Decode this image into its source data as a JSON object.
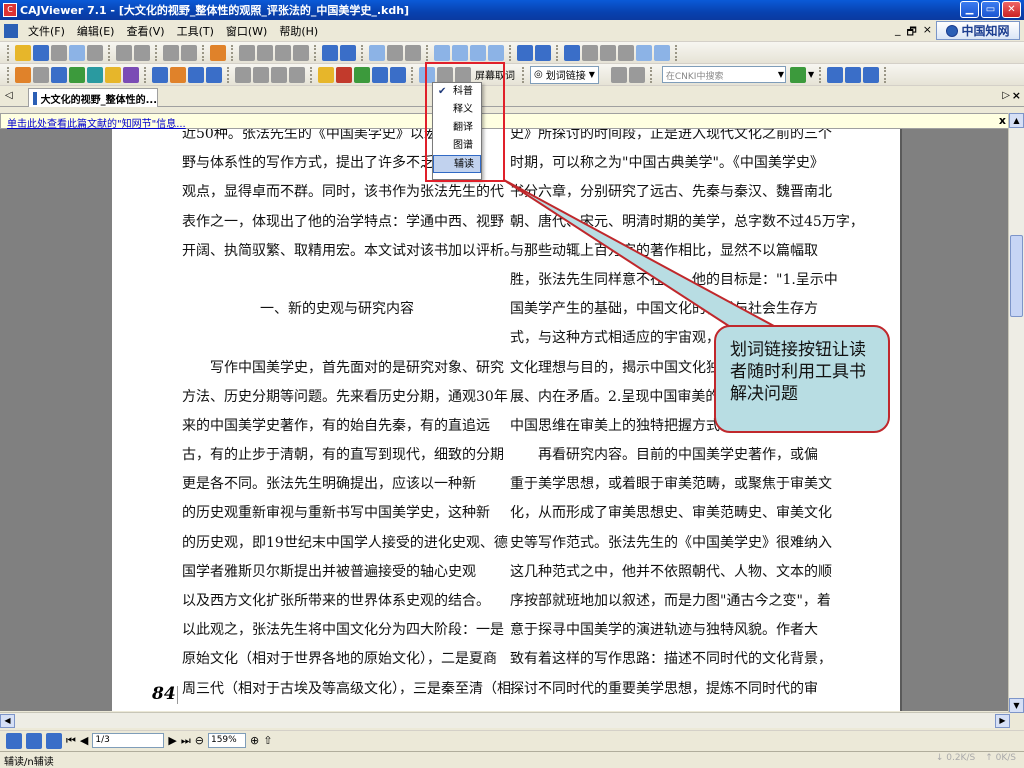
{
  "window": {
    "title": "CAJViewer 7.1 - [大文化的视野_整体性的观照_评张法的_中国美学史_.kdh]",
    "buttons": {
      "minimize": "▁",
      "maximize": "▭",
      "close": "✕"
    }
  },
  "menubar": {
    "items": [
      "文件(F)",
      "编辑(E)",
      "查看(V)",
      "工具(T)",
      "窗口(W)",
      "帮助(H)"
    ],
    "mdi_controls": [
      "_",
      "🗗",
      "×"
    ],
    "brand": "中国知网"
  },
  "toolbar2": {
    "screen_capture_label": "屏幕取词",
    "word_link_button": "划词链接",
    "search_placeholder": "在CNKI中搜索"
  },
  "word_link_menu": {
    "items": [
      {
        "label": "科普",
        "checked": true
      },
      {
        "label": "释义",
        "checked": false
      },
      {
        "label": "翻译",
        "checked": false
      },
      {
        "label": "图谱",
        "checked": false
      },
      {
        "label": "辅读",
        "checked": false,
        "hover": true
      }
    ]
  },
  "tabs": {
    "active_doc": "大文化的视野_整体性的...",
    "left_arrow": "◁",
    "right_arrow": "▷",
    "close": "×"
  },
  "infobar": {
    "link_text": "单击此处查看此篇文献的\"知网节\"信息...",
    "close": "x"
  },
  "document": {
    "left_column": [
      "近50种。张法先生的《中国美学史》以宏阔的视",
      "野与体系性的写作方式，提出了许多不乏新意的",
      "观点，显得卓而不群。同时，该书作为张法先生的代",
      "表作之一，体现出了他的治学特点：学通中西、视野",
      "开阔、执简驭繁、取精用宏。本文试对该书加以评析。",
      "",
      "一、新的史观与研究内容",
      "",
      "　　写作中国美学史，首先面对的是研究对象、研究",
      "方法、历史分期等问题。先来看历史分期，通观30年",
      "来的中国美学史著作，有的始自先秦，有的直追远",
      "古，有的止步于清朝，有的直写到现代，细致的分期",
      "更是各不同。张法先生明确提出，应该以一种新",
      "的历史观重新审视与重新书写中国美学史，这种新",
      "的历史观，即19世纪末中国学人接受的进化史观、德",
      "国学者雅斯贝尔斯提出并被普遍接受的轴心史观",
      "以及西方文化扩张所带来的世界体系史观的结合。",
      "以此观之，张法先生将中国文化分为四大阶段：一是",
      "原始文化（相对于世界各地的原始文化），二是夏商",
      "周三代（相对于古埃及等高级文化），三是秦至清（相"
    ],
    "right_column": [
      "史》所探讨的时间段，正是进入现代文化之前的三个",
      "时期，可以称之为\"中国古典美学\"。《中国美学史》",
      "书分六章，分别研究了远古、先秦与秦汉、魏晋南北",
      "朝、唐代、宋元、明清时期的美学，总字数不过45万字，",
      "与那些动辄上百万字的著作相比，显然不以篇幅取",
      "胜，张法先生同样意不在此，他的目标是：\"1.呈示中",
      "国美学产生的基础，中国文化的自然与社会生存方",
      "式，与这种方式相适应的宇宙观，生于其中的",
      "文化理想与目的，揭示中国文化独",
      "展、内在矛盾。2.呈现中国审美的",
      "中国思维在审美上的独特把握方式",
      "　　再看研究内容。目前的中国美学史著作，或偏",
      "重于美学思想，或着眼于审美范畴，或聚焦于审美文",
      "化，从而形成了审美思想史、审美范畴史、审美文化",
      "史等写作范式。张法先生的《中国美学史》很难纳入",
      "这几种范式之中，他并不依照朝代、人物、文本的顺",
      "序按部就班地加以叙述，而是力图\"通古今之变\"，着",
      "意于探寻中国美学的演进轨迹与独特风貌。作者大",
      "致有着这样的写作思路：描述不同时代的文化背景，",
      "探讨不同时代的重要美学思想，提炼不同时代的审"
    ],
    "page_number": "84"
  },
  "callout": {
    "text": "划词链接按钮让读者随时利用工具书解决问题"
  },
  "navbar": {
    "page_field": "1/3",
    "zoom_field": "159%"
  },
  "statusbar": {
    "text": "辅读/n辅读",
    "down_speed": "↓ 0.2K/S",
    "up_speed": "↑ 0K/S"
  },
  "colors": {
    "title_bar": "#0a4fc8",
    "highlight_box": "#e0202a",
    "callout_fill": "#b8dde3",
    "callout_border": "#c0282c",
    "info_link": "#0000cc",
    "page_background": "#ffffff",
    "viewer_background": "#808080"
  }
}
